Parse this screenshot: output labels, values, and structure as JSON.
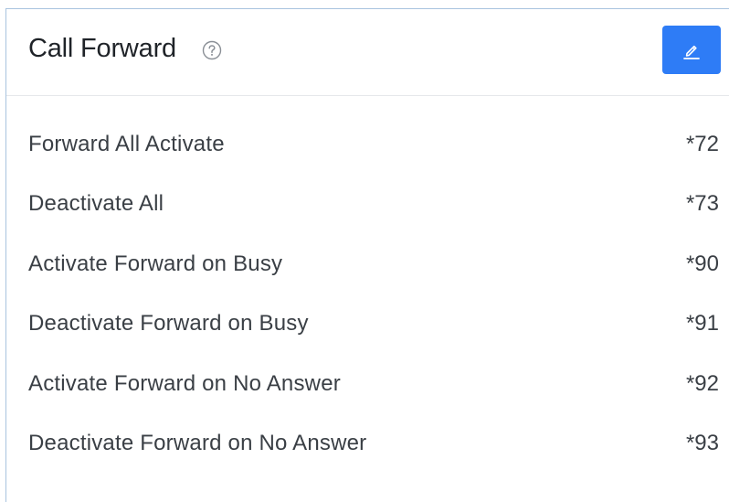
{
  "panel": {
    "title": "Call Forward",
    "help_icon": "question-circle-icon",
    "edit_icon": "pencil-icon",
    "accent_color": "#2e7cf6"
  },
  "codes": [
    {
      "label": "Forward All Activate",
      "code": "*72"
    },
    {
      "label": "Deactivate All",
      "code": "*73"
    },
    {
      "label": "Activate Forward on Busy",
      "code": "*90"
    },
    {
      "label": "Deactivate Forward on Busy",
      "code": "*91"
    },
    {
      "label": "Activate Forward on No Answer",
      "code": "*92"
    },
    {
      "label": "Deactivate Forward on No Answer",
      "code": "*93"
    }
  ]
}
